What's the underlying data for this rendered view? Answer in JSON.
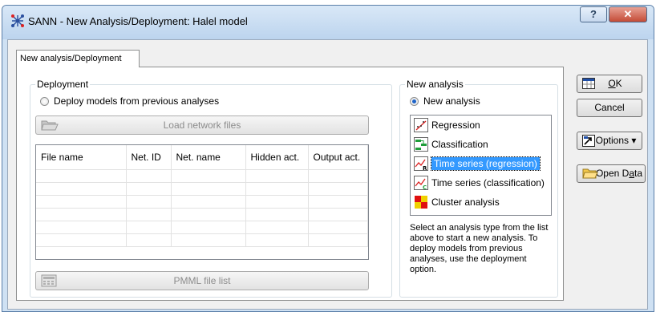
{
  "window": {
    "title": "SANN - New Analysis/Deployment: Halel   model",
    "help_label": "?",
    "close_label": "✕"
  },
  "tab": {
    "label": "New analysis/Deployment"
  },
  "deployment": {
    "group_title": "Deployment",
    "radio_label": "Deploy models from previous analyses",
    "load_button": "Load network files",
    "columns": [
      "File name",
      "Net. ID",
      "Net. name",
      "Hidden act.",
      "Output act."
    ],
    "rows": 6,
    "pmml_button": "PMML file list"
  },
  "new_analysis": {
    "group_title": "New analysis",
    "radio_label": "New analysis",
    "items": [
      {
        "label": "Regression",
        "icon": "regression-icon"
      },
      {
        "label": "Classification",
        "icon": "classification-icon"
      },
      {
        "label": "Time series (regression)",
        "icon": "time-series-regression-icon",
        "selected": true
      },
      {
        "label": "Time series (classification)",
        "icon": "time-series-classification-icon"
      },
      {
        "label": "Cluster analysis",
        "icon": "cluster-analysis-icon"
      }
    ],
    "description": "Select an analysis type from the list above to start a new analysis. To deploy models from previous analyses, use the deployment option."
  },
  "buttons": {
    "ok": {
      "prefix": "",
      "hotkey": "O",
      "suffix": "K"
    },
    "cancel": "Cancel",
    "options": "Options ▾",
    "open_data": {
      "prefix": "Open D",
      "hotkey": "a",
      "suffix": "ta"
    }
  }
}
